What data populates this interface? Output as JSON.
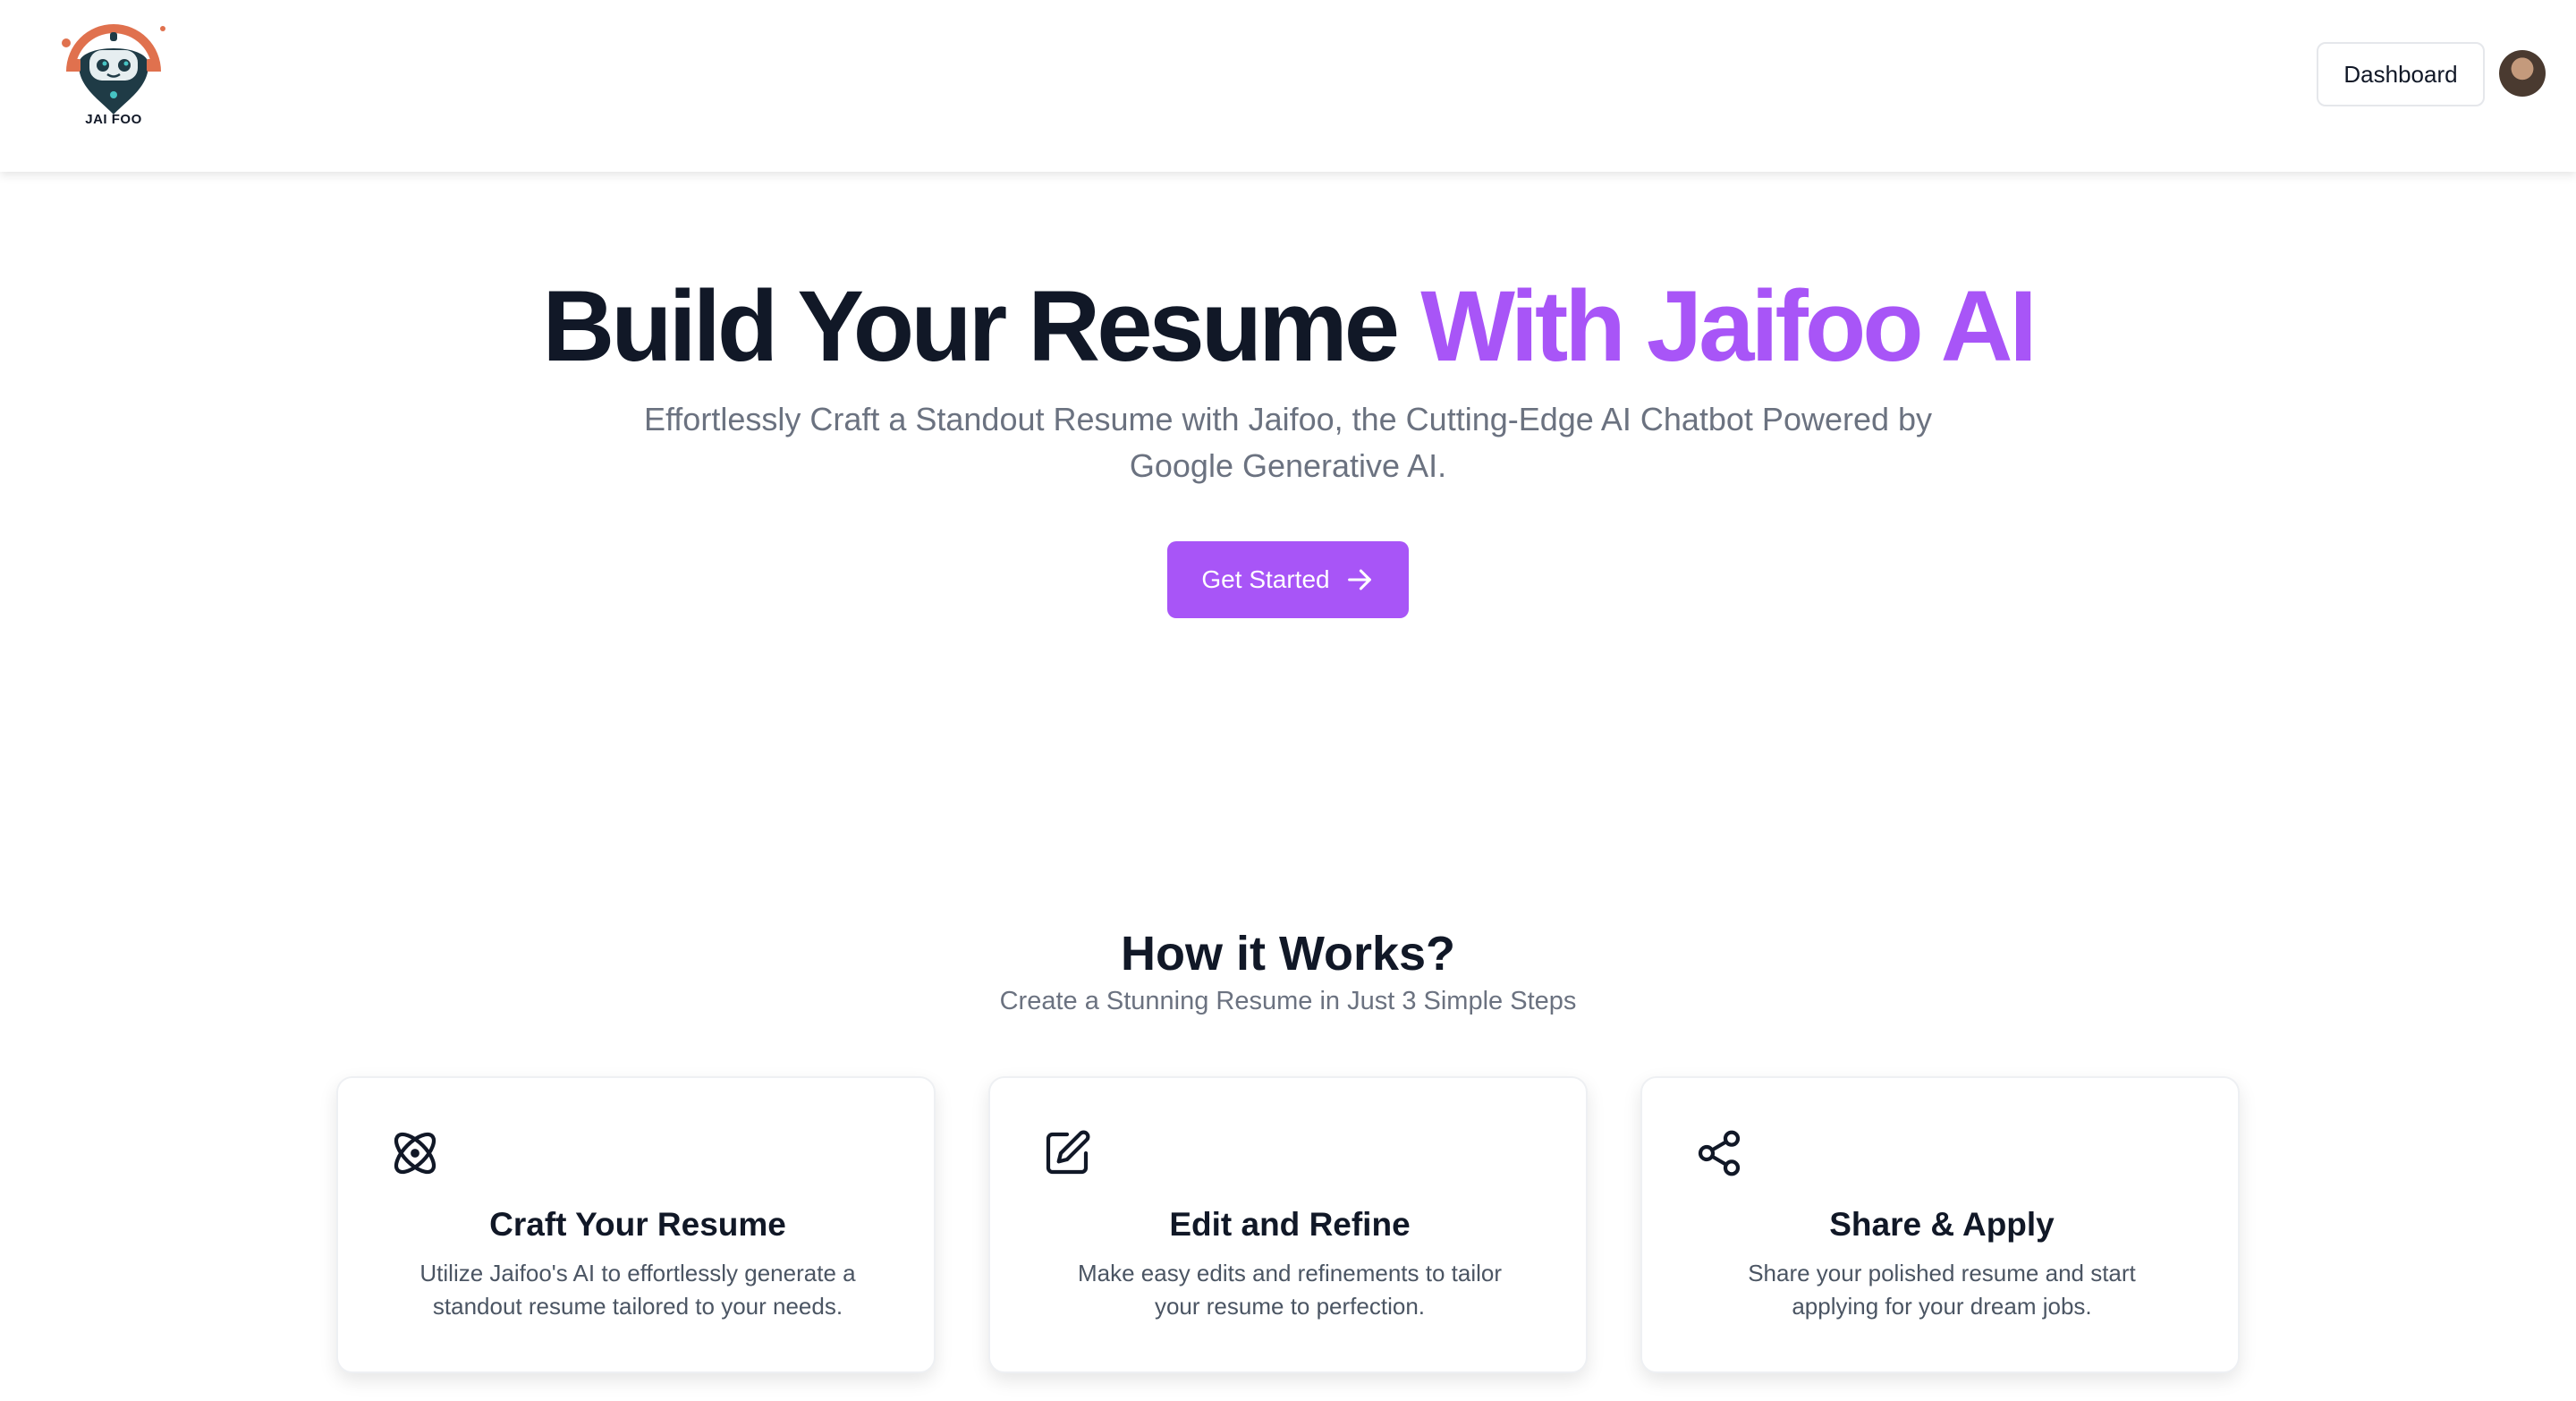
{
  "header": {
    "logo_text": "JAI FOO",
    "dashboard_label": "Dashboard"
  },
  "hero": {
    "title_main": "Build Your Resume",
    "title_accent": "With Jaifoo AI",
    "subtitle": "Effortlessly Craft a Standout Resume with Jaifoo, the Cutting-Edge AI Chatbot Powered by Google Generative AI.",
    "cta_label": "Get Started"
  },
  "how": {
    "title": "How it Works?",
    "subtitle": "Create a Stunning Resume in Just 3 Simple Steps",
    "cards": [
      {
        "icon": "atom-icon",
        "title": "Craft Your Resume",
        "description": "Utilize Jaifoo's AI to effortlessly generate a standout resume tailored to your needs."
      },
      {
        "icon": "edit-icon",
        "title": "Edit and Refine",
        "description": "Make easy edits and refinements to tailor your resume to perfection."
      },
      {
        "icon": "share-icon",
        "title": "Share & Apply",
        "description": "Share your polished resume and start applying for your dream jobs."
      }
    ]
  },
  "colors": {
    "accent": "#a855f7",
    "text": "#111827",
    "muted": "#6b7280"
  }
}
